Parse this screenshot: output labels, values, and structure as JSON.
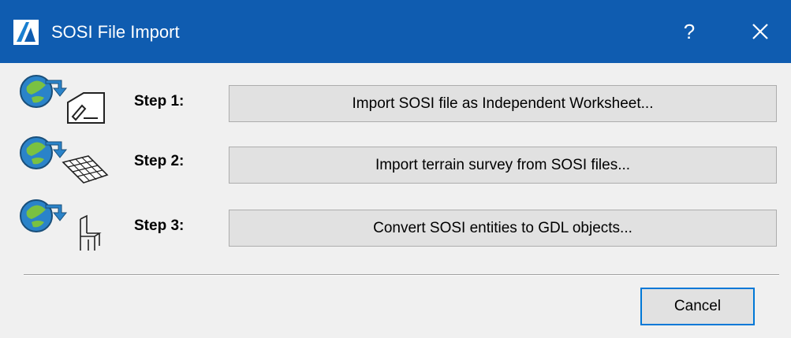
{
  "window": {
    "title": "SOSI File Import",
    "help_label": "?",
    "icons": {
      "app": "archicad-logo-icon",
      "close": "close-icon"
    },
    "colors": {
      "titlebar": "#0f5cb0",
      "button_face": "#e1e1e1",
      "button_border": "#adadad",
      "default_border": "#0078d7",
      "body": "#f0f0f0"
    }
  },
  "steps": [
    {
      "label": "Step 1:",
      "button": "Import SOSI file as Independent Worksheet...",
      "icon": "sosi-worksheet-icon"
    },
    {
      "label": "Step 2:",
      "button": "Import terrain survey from SOSI files...",
      "icon": "sosi-terrain-mesh-icon"
    },
    {
      "label": "Step 3:",
      "button": "Convert SOSI entities to GDL objects...",
      "icon": "sosi-gdl-object-icon"
    }
  ],
  "footer": {
    "cancel_label": "Cancel"
  }
}
